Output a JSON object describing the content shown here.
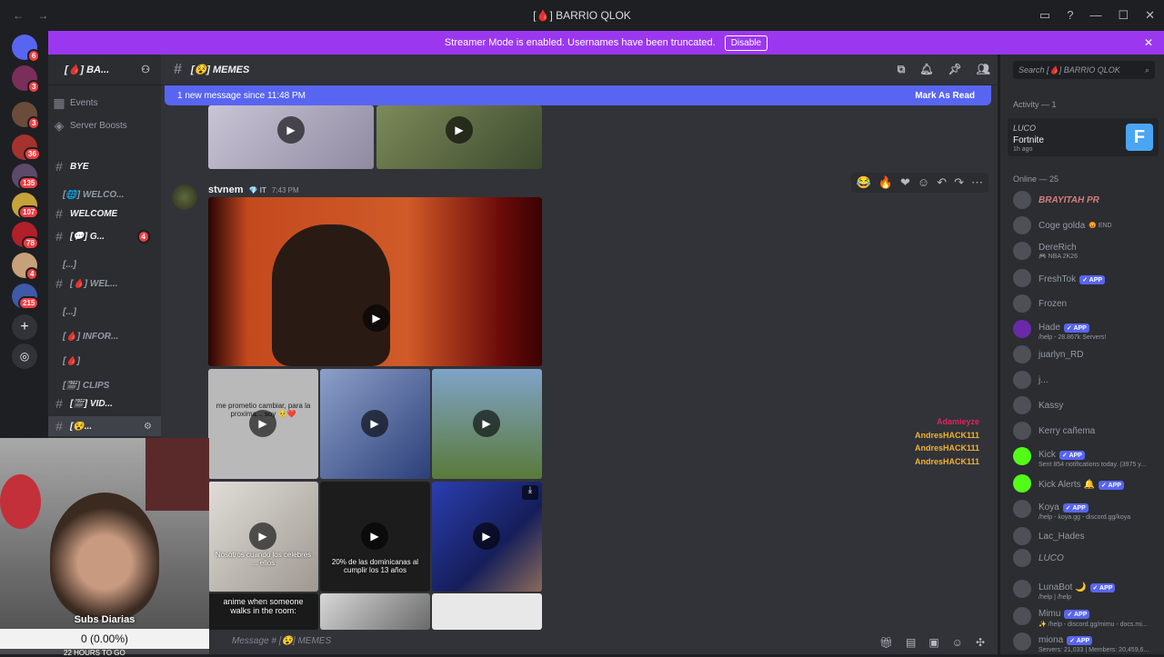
{
  "window": {
    "title": "[🩸] BARRIO QLOK"
  },
  "banner": {
    "text": "Streamer Mode is enabled. Usernames have been truncated.",
    "button": "Disable"
  },
  "server": {
    "name": "[🩸] BA..."
  },
  "channels": {
    "events": "Events",
    "boosts": "Server Boosts",
    "items": [
      {
        "label": "BYE"
      },
      {
        "label": "[🌐] WELCO...",
        "badge": ""
      },
      {
        "label": "WELCOME"
      },
      {
        "label": "[💬] G...",
        "badge": "4"
      },
      {
        "label": "[...]"
      },
      {
        "label": "[🩸] WEL..."
      },
      {
        "label": "[...]"
      },
      {
        "label": "[🩸] INFOR..."
      },
      {
        "label": "[🩸]"
      },
      {
        "label": "[🎬] CLIPS"
      },
      {
        "label": "[🎬] VID..."
      },
      {
        "label": "[😵..."
      }
    ]
  },
  "servers": {
    "badges": [
      "6",
      "3",
      "3",
      "36",
      "135",
      "107",
      "78",
      "4",
      "215"
    ]
  },
  "chat": {
    "channel_name": "[😵] MEMES",
    "new_message_text": "1 new message since 11:48 PM",
    "mark_read": "Mark As Read",
    "author": "stvnem",
    "author_tag": "💎 IT",
    "time": "7:43 PM",
    "captions": {
      "c1": "me prometio cambiar, para la proxima... soy 🥺❤️",
      "c2": "Nosotros cuando los celebres ... ellos",
      "c3": "20% de las dominicanas al cumplir los 13 años",
      "c4": "anime when someone walks in the room:"
    },
    "composer_placeholder": "Message # [😵] MEMES",
    "overlay_names": [
      "Adamieyze",
      "AndresHACK111",
      "AndresHACK111",
      "AndresHACK111"
    ]
  },
  "members": {
    "search_placeholder": "Search [🩸] BARRIO QLOK",
    "activity_header": "Activity — 1",
    "activity": {
      "user": "LUCO",
      "game": "Fortnite",
      "ago": "1h ago"
    },
    "online_header": "Online — 25",
    "list": [
      {
        "name": "BRAYITAH PR",
        "status": "",
        "app": false
      },
      {
        "name": "Coge golda",
        "status": "😡 END",
        "app": false
      },
      {
        "name": "DereRich",
        "status": "🎮 NBA 2K26",
        "app": false
      },
      {
        "name": "FreshTok",
        "status": "",
        "app": true
      },
      {
        "name": "Frozen",
        "status": "",
        "app": false
      },
      {
        "name": "Hade",
        "status": "/help - 28.867k Servers!",
        "app": true
      },
      {
        "name": "juarlyn_RD",
        "status": "",
        "app": false
      },
      {
        "name": "j...",
        "status": "",
        "app": false
      },
      {
        "name": "Kassy",
        "status": "",
        "app": false
      },
      {
        "name": "Kerry cañema",
        "status": "",
        "app": false
      },
      {
        "name": "Kick",
        "status": "Sent 854 notifications today. (3975 y...",
        "app": true
      },
      {
        "name": "Kick Alerts 🔔",
        "status": "",
        "app": true
      },
      {
        "name": "Koya",
        "status": "/help - koya.gg - discord.gg/koya",
        "app": true
      },
      {
        "name": "Lac_Hades",
        "status": "",
        "app": false
      },
      {
        "name": "LUCO",
        "status": "",
        "app": false
      },
      {
        "name": "LunaBot 🌙",
        "status": "/help | /help",
        "app": true
      },
      {
        "name": "Mimu",
        "status": "✨ /help - discord.gg/mimu - docs.mi...",
        "app": true
      },
      {
        "name": "miona",
        "status": "Servers: 21,033 | Members: 20,459,6...",
        "app": true
      }
    ],
    "app_label": "✓ APP"
  },
  "stream": {
    "subs_label": "Subs Diarias",
    "subs_value": "0 (0.00%)",
    "countdown": "22 HOURS TO GO"
  },
  "colors": {
    "blurple": "#5865f2",
    "streamer_banner": "#9b38ef",
    "bg_main": "#313338",
    "bg_side": "#2b2d31",
    "bg_dark": "#1e1f22"
  }
}
